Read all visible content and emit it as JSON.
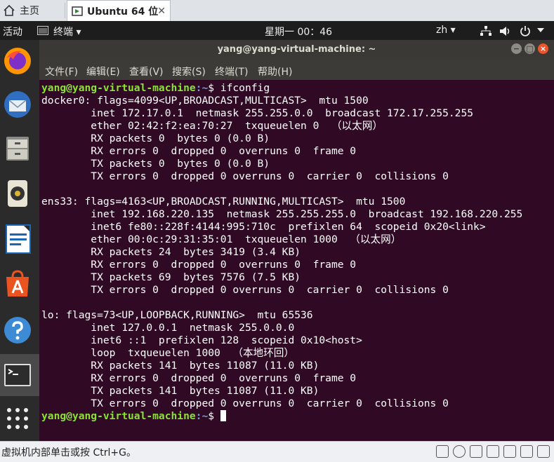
{
  "host": {
    "home_tab": "主页",
    "vm_tab": "Ubuntu 64 位",
    "close_glyph": "✕"
  },
  "panel": {
    "activities": "活动",
    "app_menu": "终端 ▾",
    "clock": "星期一 00：46",
    "input_method": "zh ▾"
  },
  "window": {
    "title": "yang@yang-virtual-machine: ~"
  },
  "menu": [
    "文件(F)",
    "编辑(E)",
    "查看(V)",
    "搜索(S)",
    "终端(T)",
    "帮助(H)"
  ],
  "terminal": {
    "user_host": "yang@yang-virtual-machine",
    "path": ":~",
    "prompt_suffix": "$ ",
    "command": "ifconfig",
    "output": "docker0: flags=4099<UP,BROADCAST,MULTICAST>  mtu 1500\n        inet 172.17.0.1  netmask 255.255.0.0  broadcast 172.17.255.255\n        ether 02:42:f2:ea:70:27  txqueuelen 0  （以太网）\n        RX packets 0  bytes 0 (0.0 B)\n        RX errors 0  dropped 0  overruns 0  frame 0\n        TX packets 0  bytes 0 (0.0 B)\n        TX errors 0  dropped 0 overruns 0  carrier 0  collisions 0\n\nens33: flags=4163<UP,BROADCAST,RUNNING,MULTICAST>  mtu 1500\n        inet 192.168.220.135  netmask 255.255.255.0  broadcast 192.168.220.255\n        inet6 fe80::228f:4144:995:710c  prefixlen 64  scopeid 0x20<link>\n        ether 00:0c:29:31:35:01  txqueuelen 1000  （以太网）\n        RX packets 24  bytes 3419 (3.4 KB)\n        RX errors 0  dropped 0  overruns 0  frame 0\n        TX packets 69  bytes 7576 (7.5 KB)\n        TX errors 0  dropped 0 overruns 0  carrier 0  collisions 0\n\nlo: flags=73<UP,LOOPBACK,RUNNING>  mtu 65536\n        inet 127.0.0.1  netmask 255.0.0.0\n        inet6 ::1  prefixlen 128  scopeid 0x10<host>\n        loop  txqueuelen 1000  （本地环回）\n        RX packets 141  bytes 11087 (11.0 KB)\n        RX errors 0  dropped 0  overruns 0  frame 0\n        TX packets 141  bytes 11087 (11.0 KB)\n        TX errors 0  dropped 0 overruns 0  carrier 0  collisions 0\n"
  },
  "status": {
    "hint": "虚拟机内部单击或按 Ctrl+G。"
  },
  "dock_apps": [
    "firefox-icon",
    "thunderbird-icon",
    "files-icon",
    "rhythmbox-icon",
    "writer-icon",
    "software-icon",
    "help-icon",
    "terminal-icon",
    "show-apps-icon"
  ]
}
